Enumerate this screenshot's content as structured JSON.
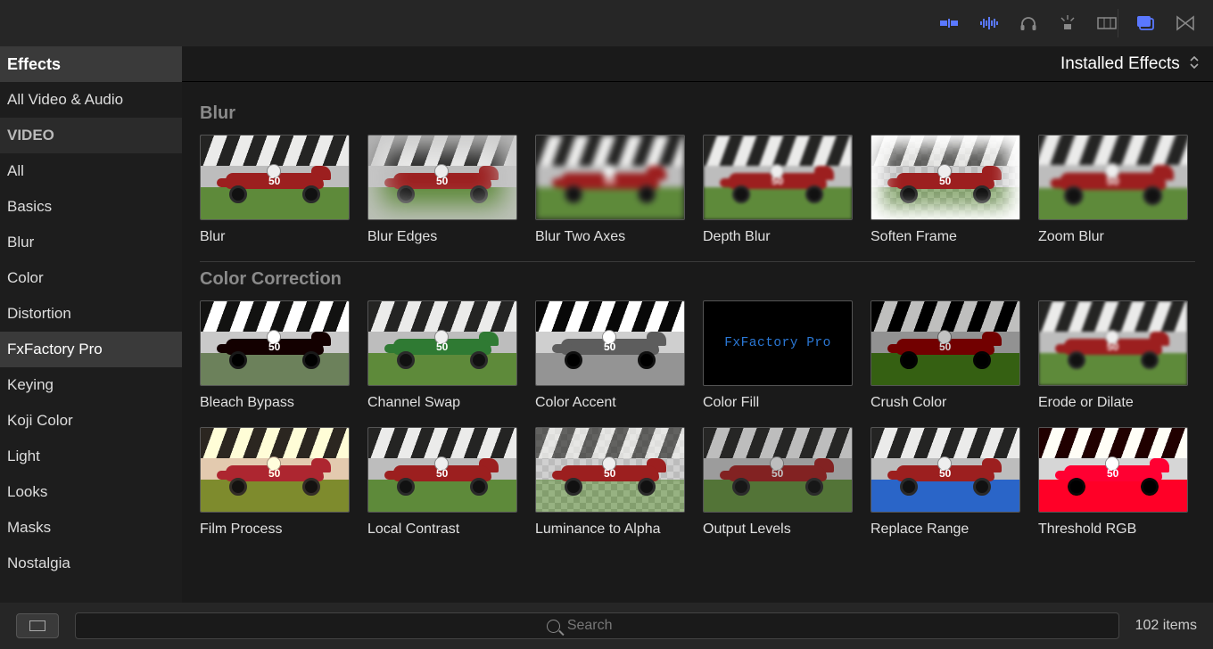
{
  "toolbar_icons": [
    "media-import-icon",
    "audio-waveform-icon",
    "headphones-icon",
    "enhance-icon",
    "filmstrip-icon",
    "browser-toggle-icon",
    "timeline-icon"
  ],
  "sidebar": {
    "header": "Effects",
    "items": [
      {
        "label": "All Video & Audio"
      },
      {
        "label": "VIDEO",
        "section": true
      },
      {
        "label": "All"
      },
      {
        "label": "Basics"
      },
      {
        "label": "Blur"
      },
      {
        "label": "Color"
      },
      {
        "label": "Distortion"
      },
      {
        "label": "FxFactory Pro",
        "selected": true
      },
      {
        "label": "Keying"
      },
      {
        "label": "Koji Color"
      },
      {
        "label": "Light"
      },
      {
        "label": "Looks"
      },
      {
        "label": "Masks"
      },
      {
        "label": "Nostalgia"
      }
    ]
  },
  "header_sort": "Installed Effects",
  "groups": [
    {
      "title": "Blur",
      "items": [
        {
          "label": "Blur",
          "variant": "car-red",
          "fx": ""
        },
        {
          "label": "Blur Edges",
          "variant": "car-red",
          "fx": "f-vignette"
        },
        {
          "label": "Blur Two Axes",
          "variant": "car-red",
          "fx": "f-blur-heavy"
        },
        {
          "label": "Depth Blur",
          "variant": "car-red",
          "fx": "f-blur"
        },
        {
          "label": "Soften Frame",
          "variant": "car-red checker",
          "fx": "f-soften"
        },
        {
          "label": "Zoom Blur",
          "variant": "car-red",
          "fx": "f-zoom f-blur-heavy"
        }
      ]
    },
    {
      "title": "Color Correction",
      "items": [
        {
          "label": "Bleach Bypass",
          "variant": "car-dark",
          "fx": "f-desat"
        },
        {
          "label": "Channel Swap",
          "variant": "car-green",
          "fx": ""
        },
        {
          "label": "Color Accent",
          "variant": "car-green grass-gray",
          "fx": "f-mono"
        },
        {
          "label": "Color Fill",
          "fill": "FxFactory Pro"
        },
        {
          "label": "Crush Color",
          "variant": "car-red",
          "fx": "f-dark"
        },
        {
          "label": "Erode or Dilate",
          "variant": "car-red",
          "fx": "f-blur"
        },
        {
          "label": "Film Process",
          "variant": "car-red",
          "fx": "f-warm"
        },
        {
          "label": "Local Contrast",
          "variant": "car-red",
          "fx": ""
        },
        {
          "label": "Luminance to Alpha",
          "variant": "car-red checker",
          "fx": ""
        },
        {
          "label": "Output Levels",
          "variant": "car-red",
          "fx": "f-fade"
        },
        {
          "label": "Replace Range",
          "variant": "car-red grass-blue",
          "fx": ""
        },
        {
          "label": "Threshold RGB",
          "variant": "car-red grass-orange sky-orange",
          "fx": "f-hot"
        }
      ]
    }
  ],
  "search": {
    "placeholder": "Search"
  },
  "item_count": "102 items",
  "car_number": "50"
}
